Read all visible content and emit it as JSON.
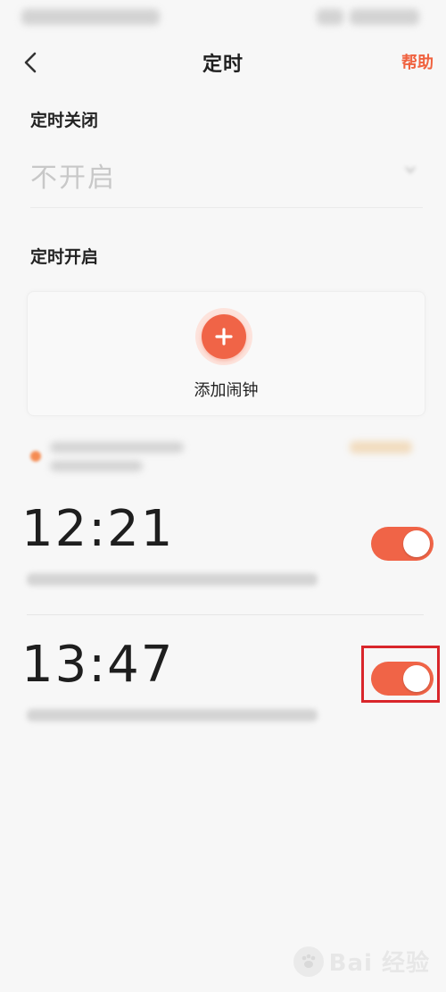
{
  "header": {
    "title": "定时",
    "help_label": "帮助"
  },
  "timed_close": {
    "heading": "定时关闭",
    "select_value": "不开启"
  },
  "timed_open": {
    "heading": "定时开启",
    "add_alarm_label": "添加闹钟"
  },
  "alarms": [
    {
      "time": "12:21",
      "enabled": true
    },
    {
      "time": "13:47",
      "enabled": true
    }
  ],
  "colors": {
    "accent": "#f06447",
    "help_text": "#f0623f",
    "highlight_box": "#d9262b"
  },
  "icons": {
    "back": "back-chevron-icon",
    "add": "plus-icon",
    "dropdown": "chevron-down-icon"
  },
  "watermark": {
    "text": "Bai 经验"
  }
}
